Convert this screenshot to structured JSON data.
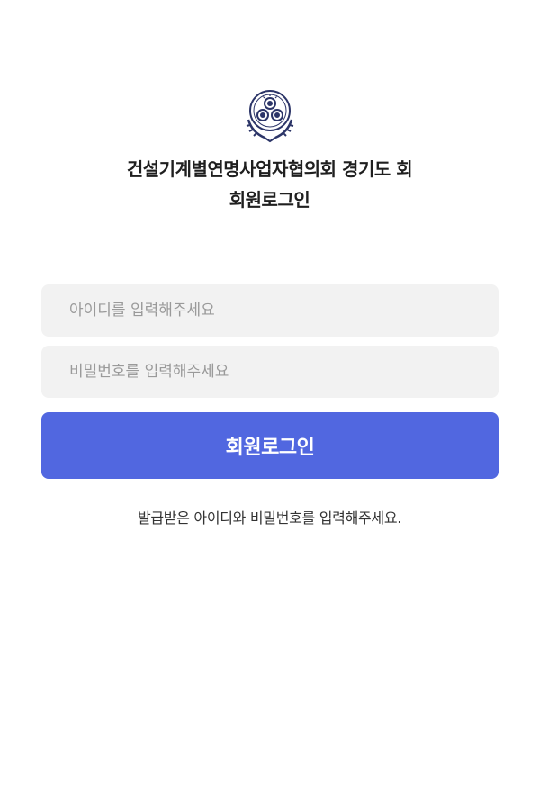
{
  "header": {
    "title_line1": "건설기계별연명사업자협의회 경기도 회",
    "title_line2": "회원로그인"
  },
  "form": {
    "id_placeholder": "아이디를 입력해주세요",
    "id_value": "",
    "password_placeholder": "비밀번호를 입력해주세요",
    "password_value": "",
    "submit_label": "회원로그인"
  },
  "helper_text": "발급받은 아이디와 비밀번호를 입력해주세요.",
  "colors": {
    "primary_button": "#5167e0",
    "input_background": "#f2f2f2",
    "emblem": "#2c3568"
  },
  "icons": {
    "emblem": "association-emblem-icon"
  }
}
